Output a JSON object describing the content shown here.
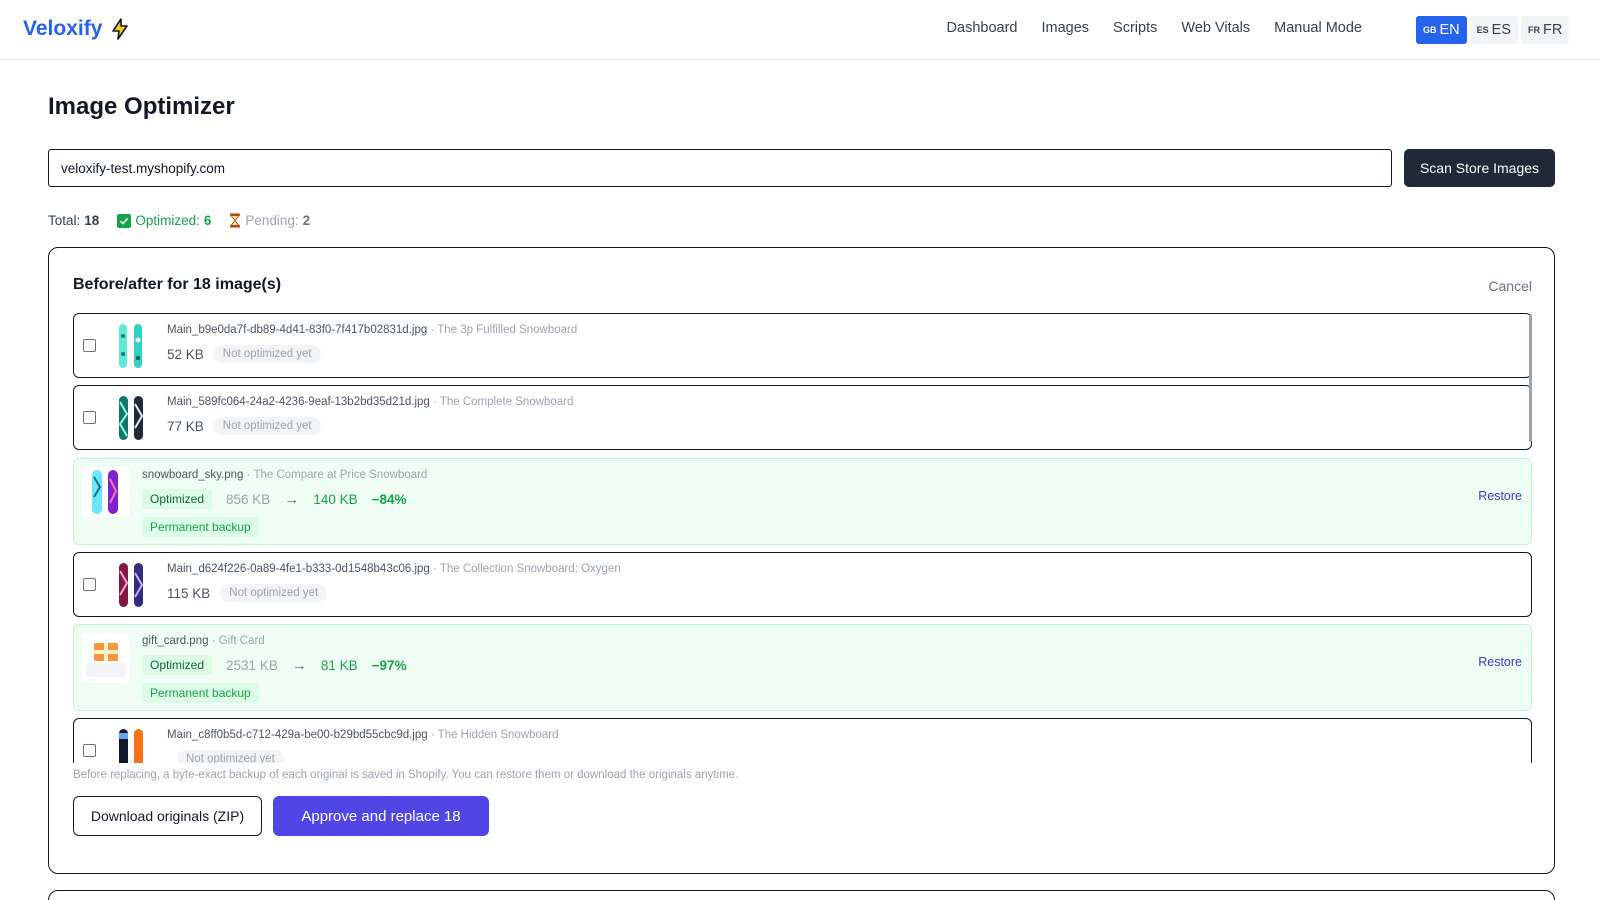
{
  "app": {
    "brand": "Veloxify",
    "brand_icon": "lightning-icon"
  },
  "nav": {
    "items": [
      "Dashboard",
      "Images",
      "Scripts",
      "Web Vitals",
      "Manual Mode"
    ]
  },
  "languages": [
    {
      "code": "GB",
      "label": "EN",
      "active": true
    },
    {
      "code": "ES",
      "label": "ES",
      "active": false
    },
    {
      "code": "FR",
      "label": "FR",
      "active": false
    }
  ],
  "page": {
    "title": "Image Optimizer",
    "store_url": "veloxify-test.myshopify.com",
    "scan_button": "Scan Store Images"
  },
  "stats": {
    "total_label": "Total:",
    "total": "18",
    "optimized_label": "Optimized:",
    "optimized": "6",
    "pending_label": "Pending:",
    "pending": "2"
  },
  "panel": {
    "title": "Before/after for 18 image(s)",
    "cancel": "Cancel",
    "not_optimized_badge": "Not optimized yet",
    "optimized_badge": "Optimized",
    "backup_badge": "Permanent backup",
    "restore_label": "Restore",
    "footnote": "Before replacing, a byte-exact backup of each original is saved in Shopify. You can restore them or download the originals anytime.",
    "download_button": "Download originals (ZIP)",
    "approve_button": "Approve and replace 18"
  },
  "images": [
    {
      "status": "pending",
      "file": "Main_b9e0da7f-db89-4d41-83f0-7f417b02831d.jpg",
      "product": " · The 3p Fulfilled Snowboard",
      "size": "52 KB",
      "thumb": "snowboard-mint"
    },
    {
      "status": "pending",
      "file": "Main_589fc064-24a2-4236-9eaf-13b2bd35d21d.jpg",
      "product": " · The Complete Snowboard",
      "size": "77 KB",
      "thumb": "snowboard-teal"
    },
    {
      "status": "optimized",
      "file": "snowboard_sky.png",
      "product": " · The Compare at Price Snowboard",
      "old_size": "856 KB",
      "arrow": "→",
      "new_size": "140 KB",
      "pct": "−84%",
      "thumb": "snowboard-sky"
    },
    {
      "status": "pending",
      "file": "Main_d624f226-0a89-4fe1-b333-0d1548b43c06.jpg",
      "product": " · The Collection Snowboard: Oxygen",
      "size": "115 KB",
      "thumb": "snowboard-dark"
    },
    {
      "status": "optimized",
      "file": "gift_card.png",
      "product": " · Gift Card",
      "old_size": "2531 KB",
      "arrow": "→",
      "new_size": "81 KB",
      "pct": "−97%",
      "thumb": "gift-card"
    },
    {
      "status": "pending",
      "file": "Main_c8ff0b5d-c712-429a-be00-b29bd55cbc9d.jpg",
      "product": " · The Hidden Snowboard",
      "size": "",
      "thumb": "snowboard-hidden"
    }
  ],
  "colors": {
    "brand": "#2563eb",
    "primary": "#4f46e5",
    "success": "#16a34a",
    "success_bg": "#f0fdf4",
    "dark_button": "#1f2937"
  }
}
